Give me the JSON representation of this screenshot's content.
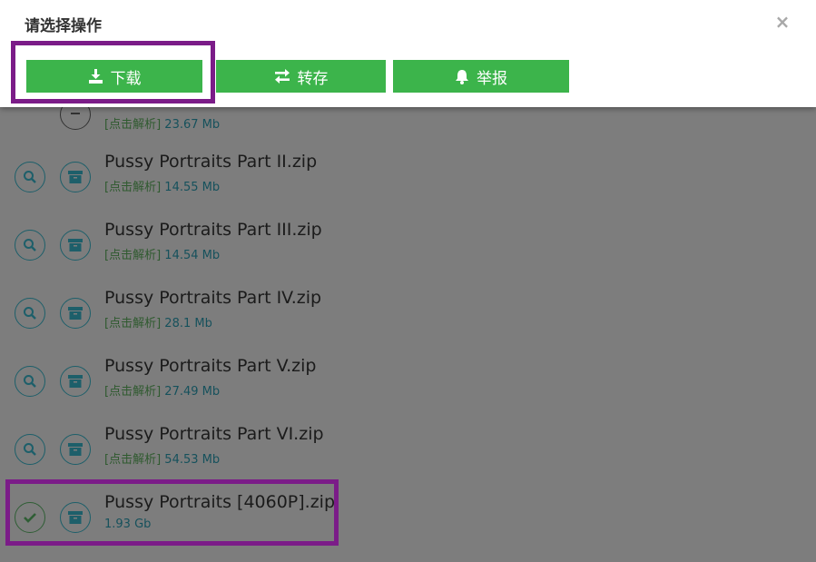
{
  "modal": {
    "title": "请选择操作",
    "close_icon": "close-icon",
    "buttons": {
      "download": {
        "label": "下载",
        "icon": "download-icon"
      },
      "transfer": {
        "label": "转存",
        "icon": "transfer-icon"
      },
      "report": {
        "label": "举报",
        "icon": "bell-icon"
      }
    }
  },
  "files": [
    {
      "name": "",
      "parse_label": "[点击解析]",
      "size": "23.67 Mb"
    },
    {
      "name": "Pussy Portraits Part II.zip",
      "parse_label": "[点击解析]",
      "size": "14.55 Mb"
    },
    {
      "name": "Pussy Portraits Part III.zip",
      "parse_label": "[点击解析]",
      "size": "14.54 Mb"
    },
    {
      "name": "Pussy Portraits Part IV.zip",
      "parse_label": "[点击解析]",
      "size": "28.1 Mb"
    },
    {
      "name": "Pussy Portraits Part V.zip",
      "parse_label": "[点击解析]",
      "size": "27.49 Mb"
    },
    {
      "name": "Pussy Portraits Part VI.zip",
      "parse_label": "[点击解析]",
      "size": "54.53 Mb"
    },
    {
      "name": "Pussy Portraits [4060P].zip",
      "size": "1.93 Gb",
      "selected": true
    }
  ],
  "colors": {
    "accent_green": "#3cb44b",
    "highlight_purple": "#7b1c88",
    "overlay_gray": "#7d7d7d"
  }
}
